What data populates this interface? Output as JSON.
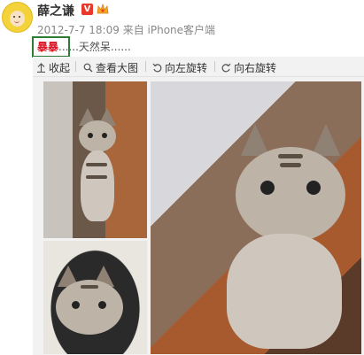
{
  "user": {
    "name": "薛之谦",
    "badge": "V"
  },
  "post": {
    "date": "2012-7-7 18:09",
    "source": "来自 iPhone客户端",
    "highlight": "暴暴",
    "text": "......天然呆......"
  },
  "toolbar": {
    "collapse": "收起",
    "view_large": "查看大图",
    "rotate_left": "向左旋转",
    "rotate_right": "向右旋转"
  },
  "colors": {
    "highlight": "#dd1122",
    "highlight_box": "#2e7a37",
    "verified_badge": "#e8392b"
  },
  "icons": [
    "collapse-arrow-icon",
    "magnify-icon",
    "rotate-left-icon",
    "rotate-right-icon"
  ]
}
